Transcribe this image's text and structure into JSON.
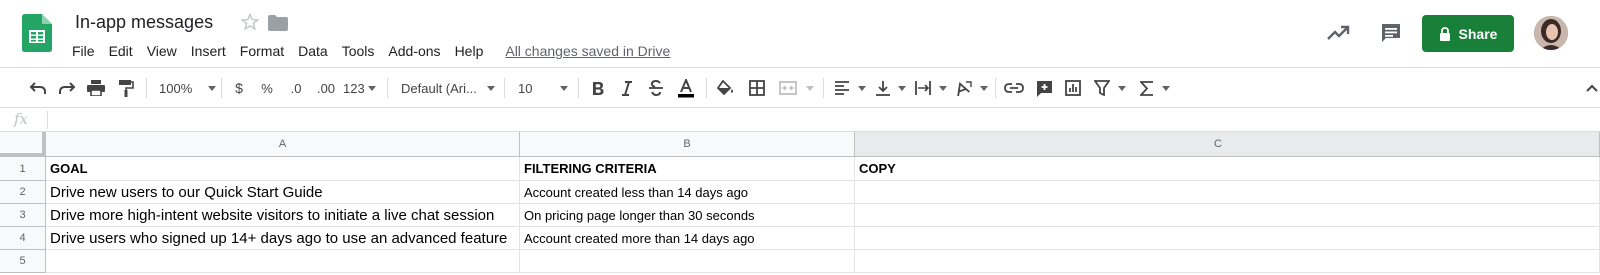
{
  "document": {
    "title": "In-app messages",
    "saved_status": "All changes saved in Drive"
  },
  "menu": [
    "File",
    "Edit",
    "View",
    "Insert",
    "Format",
    "Data",
    "Tools",
    "Add-ons",
    "Help"
  ],
  "share": {
    "label": "Share"
  },
  "toolbar": {
    "zoom": "100%",
    "currency": "$",
    "percent": "%",
    "decrease_decimal": ".0",
    "increase_decimal": ".00",
    "more_formats": "123",
    "font_family": "Default (Ari...",
    "font_size": "10"
  },
  "formula_bar": {
    "fx": "fx",
    "value": ""
  },
  "columns": [
    "A",
    "B",
    "C"
  ],
  "rows": [
    "1",
    "2",
    "3",
    "4",
    "5"
  ],
  "cells": {
    "a1": "GOAL",
    "b1": "FILTERING CRITERIA",
    "c1": "COPY",
    "a2": "Drive new users to our Quick Start Guide",
    "b2": "Account created less than 14 days ago",
    "c2": "",
    "a3": "Drive more high-intent website visitors to initiate a live chat session",
    "b3": "On pricing page longer than 30 seconds",
    "c3": "",
    "a4": "Drive users who signed up 14+ days ago to use an advanced feature",
    "b4": "Account created more than 14 days ago",
    "c4": "",
    "a5": "",
    "b5": "",
    "c5": ""
  },
  "colors": {
    "share_green": "#188038",
    "sheets_green": "#23a566",
    "header_bg": "#f8f9fa"
  }
}
